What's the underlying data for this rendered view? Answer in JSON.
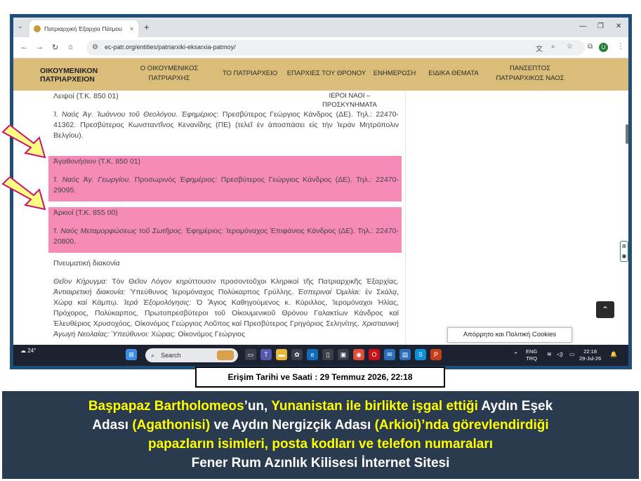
{
  "browser": {
    "tab_title": "Πατριαρχική Έξαρχία Πάτμου",
    "tab_close": "×",
    "new_tab": "+",
    "url": "ec-patr.org/entities/patriarxiki-eksarxia-patmoy/",
    "profile_initial": "U"
  },
  "site_nav": {
    "logo_line1": "ΟΙΚΟΥΜΕΝΙΚΟΝ",
    "logo_line2": "ΠΑΤΡΙΑΡΧΕΙΟΝ",
    "items": [
      {
        "line1": "Ο ΟΙΚΟΥΜΕΝΙΚΟΣ",
        "line2": "ΠΑΤΡΙΑΡΧΗΣ"
      },
      {
        "line1": "ΤΟ ΠΑΤΡΙΑΡΧΕΙΟ",
        "line2": ""
      },
      {
        "line1": "ΕΠΑΡΧΙΕΣ ΤΟΥ ΘΡΟΝΟΥ",
        "line2": ""
      },
      {
        "line1": "ΕΝΗΜΕΡΩΣΗ",
        "line2": ""
      },
      {
        "line1": "ΕΙΔΙΚΑ ΘΕΜΑΤΑ",
        "line2": ""
      },
      {
        "line1": "ΠΑΝΣΕΠΤΟΣ",
        "line2": "ΠΑΤΡΙΑΡΧΙΚΟΣ ΝΑΟΣ"
      }
    ]
  },
  "content": {
    "holy_temples_line1": "ΙΕΡΟΙ ΝΑΟΙ –",
    "holy_temples_line2": "ΠΡΟΣΚΥΝΗΜΑΤΑ",
    "lipsi_heading": "Λειψοί (Τ.Κ. 850 01)",
    "lipsi_italic": "Ἱ. Ναός Ἁγ. Ἰωάννου τοῦ Θεολόγου. Ἐφημέριος",
    "lipsi_text": ": Πρεσβύτερος Γεώργιος Κάνδρος (ΔΕ). Τηλ.: 22470-41362. Πρεσβύτερος Κωνσταντῖνος Κενανίδης (ΠΕ) (τελεῖ ἐν ἀποσπάσει εἰς τὴν Ἱεράν Μητρόπολιν Βελγίου).",
    "agathonisi_heading": "Ἀγαθονήσιον (Τ.Κ. 850 01)",
    "agathonisi_italic": "Ἱ. Ναός Ἁγ. Γεωργίου.",
    "agathonisi_text_a": " Προσωρινός ",
    "agathonisi_italic_b": "Ἐφημέριος:",
    "agathonisi_text_b": " Πρεσβύτερος Γεώργιος Κάνδρος (ΔΕ). Τηλ.: 22470-29095.",
    "arkioi_heading": "Ἀρκιοί (Τ.Κ. 855 00)",
    "arkioi_italic": "Ἱ. Ναός Μεταμορφώσεως τοῦ Σωτῆρος.",
    "arkioi_text": " Ἐφημέριος: Ἱερομόναχος Ἐπιφάνιος Κάνδρος (ΔΕ). Τηλ.: 22470-20800.",
    "spiritual_heading": "Πνευματική διακονία",
    "spiritual_p1_italic": "Θεῖον Κήρυγμα:",
    "spiritual_p1": " Τὸν Θεῖον Λόγον κηρύττουσιν προσοντοῦχοι Κληρικοί τῆς Πατριαρχικῆς Ἐξαρχίας. ",
    "spiritual_p2_italic": "Ἀντιαιρετική διακονία:",
    "spiritual_p2": " Ὑπεύθυνος Ἱερομόναχος Πολύκαρπος Γρύλλης. ",
    "spiritual_p3_italic": "Ἑσπεριναί Ὁμιλίαι:",
    "spiritual_p3": " ἐν Σκάλᾳ, Χώρᾳ καί Κάμπῳ. ",
    "spiritual_p4_italic": "Ἱερά Ἐξομολόγησις:",
    "spiritual_p4": " Ὁ Ἅγιος Καθηγούμενος κ. Κύριλλος, Ἱερομόναχοι Ἠλίας, Πρόχορος, Πολύκαρπος, Πρωτοπρεσβύτεροι τοῦ Οἰκουμενικοῦ Θρόνου Γαλακτίων Κάνδρος καί Ἐλευθέριος Χρυσοχόος, Οἰκονόμος Γεώργιος Λοῦπος καί Πρεσβύτερος Γρηγόριος Σεληνίτης. ",
    "spiritual_p5_italic": "Χριστιανική Ἀγωγή Νεολαίας: Ὑπεύθυνοι:",
    "spiritual_p5": " Χώρας: Οἰκονόμος Γεώργιος",
    "cookie_notice": "Απόρρητο και Πολιτική Cookies",
    "scroll_top": "⌃"
  },
  "taskbar": {
    "temperature": "24°",
    "search_placeholder": "Search",
    "lang_line1": "ENG",
    "lang_line2": "TRQ",
    "time": "22:18",
    "date": "29-Jul-26"
  },
  "stamp": {
    "text": "Erişim Tarihi ve Saati : 29 Temmuz 2026, 22:18"
  },
  "caption": {
    "l1_a": "Başpapaz Bartholomeos",
    "l1_b": "’un, ",
    "l1_c": "Yunanistan ile birlikte işgal ettiği",
    "l1_d": " Aydın Eşek",
    "l2_a": "Adası",
    "l2_b": " (Agathonisi) ",
    "l2_c": "ve",
    "l2_d": " Aydın Nergizçik Adası",
    "l2_e": " (Arkioi)",
    "l2_f": "’nda görevlendirdiği",
    "l3": "papazların isimleri, posta kodları ve telefon numaraları",
    "l4": "Fener Rum Azınlık Kilisesi İnternet Sitesi"
  },
  "colors": {
    "highlight": "#f68bb8",
    "nav_bg": "#d9bd78",
    "caption_bg": "#2a3a4f",
    "caption_yellow": "#ffff00",
    "arrow_fill": "#ffff80",
    "arrow_stroke": "#cc1177"
  }
}
